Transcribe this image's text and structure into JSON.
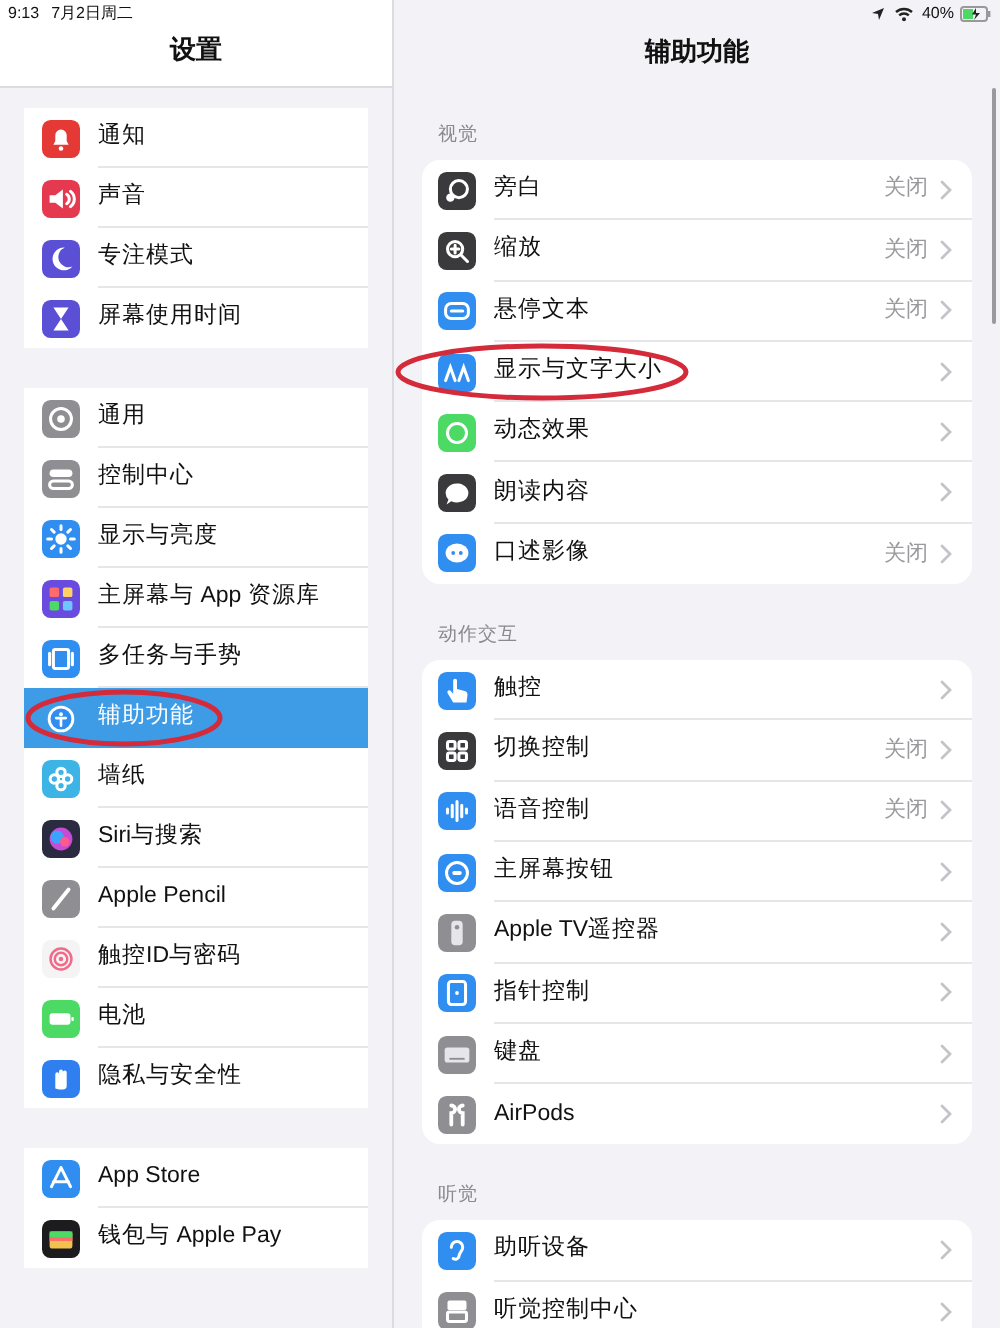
{
  "status_bar": {
    "time": "9:13",
    "date": "7月2日周二",
    "battery": "40%"
  },
  "sidebar": {
    "title": "设置",
    "groups": [
      [
        {
          "label": "通知",
          "color": "#e53935",
          "selected": false,
          "circled": false
        },
        {
          "label": "声音",
          "color": "#e5394f",
          "selected": false,
          "circled": false
        },
        {
          "label": "专注模式",
          "color": "#5b4fd6",
          "selected": false,
          "circled": false
        },
        {
          "label": "屏幕使用时间",
          "color": "#5b4fd6",
          "selected": false,
          "circled": false
        }
      ],
      [
        {
          "label": "通用",
          "color": "#8e8e93",
          "selected": false,
          "circled": false
        },
        {
          "label": "控制中心",
          "color": "#8e8e93",
          "selected": false,
          "circled": false
        },
        {
          "label": "显示与亮度",
          "color": "#2f8ef0",
          "selected": false,
          "circled": false
        },
        {
          "label": "主屏幕与 App 资源库",
          "color": "#6a4be0",
          "selected": false,
          "circled": false
        },
        {
          "label": "多任务与手势",
          "color": "#2f8ef0",
          "selected": false,
          "circled": false
        },
        {
          "label": "辅助功能",
          "color": "#2f8ef0",
          "selected": true,
          "circled": true
        },
        {
          "label": "墙纸",
          "color": "#3cb4e6",
          "selected": false,
          "circled": false
        },
        {
          "label": "Siri与搜索",
          "color": "#2a2a40",
          "selected": false,
          "circled": false
        },
        {
          "label": "Apple Pencil",
          "color": "#8e8e93",
          "selected": false,
          "circled": false
        },
        {
          "label": "触控ID与密码",
          "color": "#f4f4f4",
          "selected": false,
          "circled": false
        },
        {
          "label": "电池",
          "color": "#4cd964",
          "selected": false,
          "circled": false
        },
        {
          "label": "隐私与安全性",
          "color": "#2f7ff0",
          "selected": false,
          "circled": false
        }
      ],
      [
        {
          "label": "App Store",
          "color": "#2f8ef0",
          "selected": false,
          "circled": false
        },
        {
          "label": "钱包与 Apple Pay",
          "color": "#1c1c1e",
          "selected": false,
          "circled": false
        }
      ]
    ]
  },
  "detail": {
    "title": "辅助功能",
    "sections": [
      {
        "header": "视觉",
        "rows": [
          {
            "label": "旁白",
            "value": "关闭",
            "color": "#3a3a3c",
            "circled": false
          },
          {
            "label": "缩放",
            "value": "关闭",
            "color": "#3a3a3c",
            "circled": false
          },
          {
            "label": "悬停文本",
            "value": "关闭",
            "color": "#2f8ef0",
            "circled": false
          },
          {
            "label": "显示与文字大小",
            "color": "#2f8ef0",
            "circled": true
          },
          {
            "label": "动态效果",
            "color": "#4cd964",
            "circled": false
          },
          {
            "label": "朗读内容",
            "color": "#3a3a3c",
            "circled": false
          },
          {
            "label": "口述影像",
            "value": "关闭",
            "color": "#2f8ef0",
            "circled": false
          }
        ]
      },
      {
        "header": "动作交互",
        "rows": [
          {
            "label": "触控",
            "color": "#2f8ef0",
            "circled": false
          },
          {
            "label": "切换控制",
            "value": "关闭",
            "color": "#3a3a3c",
            "circled": false
          },
          {
            "label": "语音控制",
            "value": "关闭",
            "color": "#2f8ef0",
            "circled": false
          },
          {
            "label": "主屏幕按钮",
            "color": "#2f8ef0",
            "circled": false
          },
          {
            "label": "Apple TV遥控器",
            "color": "#8e8e93",
            "circled": false
          },
          {
            "label": "指针控制",
            "color": "#2f8ef0",
            "circled": false
          },
          {
            "label": "键盘",
            "color": "#8e8e93",
            "circled": false
          },
          {
            "label": "AirPods",
            "color": "#8e8e93",
            "circled": false
          }
        ]
      },
      {
        "header": "听觉",
        "rows": [
          {
            "label": "助听设备",
            "color": "#2f8ef0",
            "circled": false
          },
          {
            "label": "听觉控制中心",
            "color": "#8e8e93",
            "circled": false
          }
        ]
      }
    ]
  }
}
